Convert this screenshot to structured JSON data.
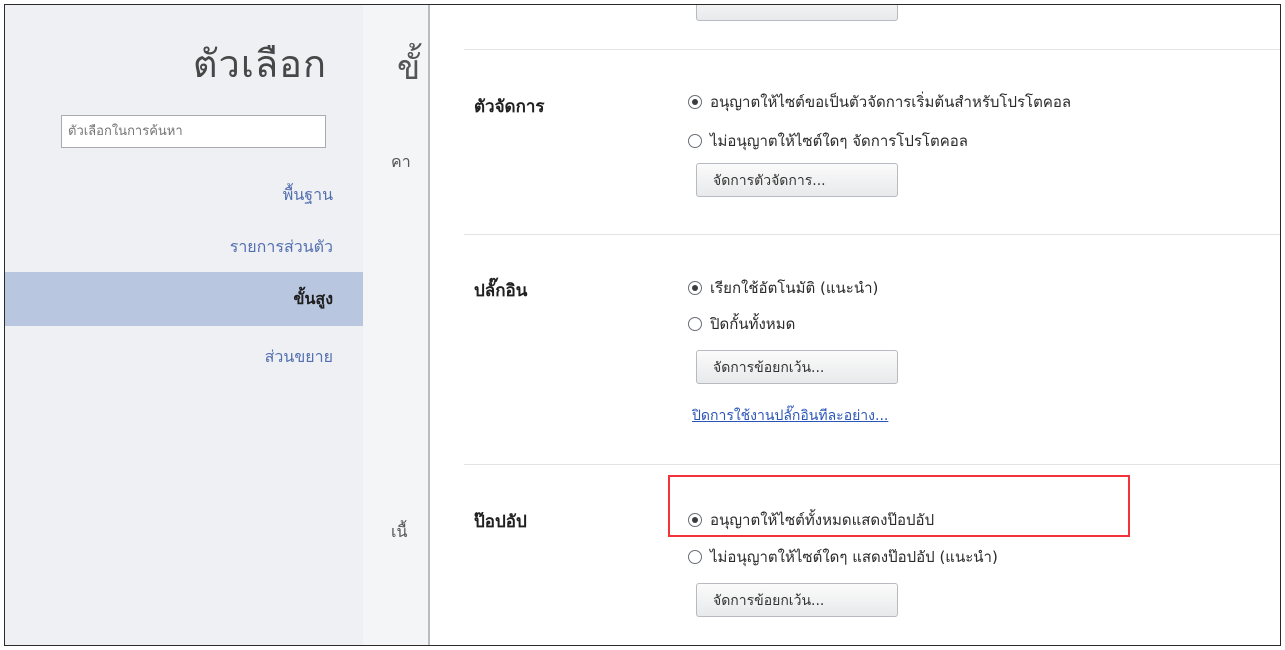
{
  "sidebar": {
    "title": "ตัวเลือก",
    "search_placeholder": "ตัวเลือกในการค้นหา",
    "items": [
      {
        "label": "พื้นฐาน",
        "active": false
      },
      {
        "label": "รายการส่วนตัว",
        "active": false
      },
      {
        "label": "ขั้นสูง",
        "active": true
      },
      {
        "label": "ส่วนขยาย",
        "active": false
      }
    ]
  },
  "middle": {
    "peek_top": "ขั้",
    "peek_mid": "คา",
    "peek_bottom": "เนื้"
  },
  "handlers": {
    "title": "ตัวจัดการ",
    "option_allow": "อนุญาตให้ไซต์ขอเป็นตัวจัดการเริ่มต้นสำหรับโปรโตคอล",
    "option_deny": "ไม่อนุญาตให้ไซต์ใดๆ จัดการโปรโตคอล",
    "button": "จัดการตัวจัดการ..."
  },
  "plugins": {
    "title": "ปลั๊กอิน",
    "option_auto": "เรียกใช้อัตโนมัติ (แนะนำ)",
    "option_block": "ปิดกั้นทั้งหมด",
    "button": "จัดการข้อยกเว้น...",
    "link": "ปิดการใช้งานปลั๊กอินทีละอย่าง..."
  },
  "popups": {
    "title": "ป๊อปอัป",
    "option_allow": "อนุญาตให้ไซต์ทั้งหมดแสดงป๊อปอัป",
    "option_deny": "ไม่อนุญาตให้ไซต์ใดๆ แสดงป๊อปอัป (แนะนำ)",
    "button": "จัดการข้อยกเว้น..."
  },
  "colors": {
    "active_nav_bg": "#b8c6df",
    "link": "#2a55b8",
    "highlight_border": "#f2343a"
  }
}
